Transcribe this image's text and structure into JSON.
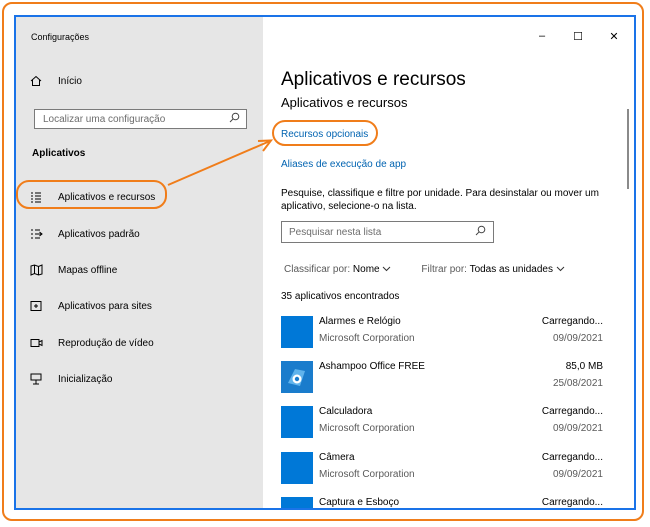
{
  "window": {
    "title": "Configurações",
    "controls": {
      "minimize": "–",
      "maximize": "☐",
      "close": "✕"
    }
  },
  "sidebar": {
    "home_label": "Início",
    "search_placeholder": "Localizar uma configuração",
    "section_title": "Aplicativos",
    "items": [
      {
        "label": "Aplicativos e recursos",
        "icon": "apps-features-icon"
      },
      {
        "label": "Aplicativos padrão",
        "icon": "default-apps-icon"
      },
      {
        "label": "Mapas offline",
        "icon": "offline-maps-icon"
      },
      {
        "label": "Aplicativos para sites",
        "icon": "apps-for-websites-icon"
      },
      {
        "label": "Reprodução de vídeo",
        "icon": "video-playback-icon"
      },
      {
        "label": "Inicialização",
        "icon": "startup-icon"
      }
    ]
  },
  "main": {
    "title": "Aplicativos e recursos",
    "subtitle": "Aplicativos e recursos",
    "link_optional": "Recursos opcionais",
    "link_aliases": "Aliases de execução de app",
    "description": "Pesquise, classifique e filtre por unidade. Para desinstalar ou mover um aplicativo, selecione-o na lista.",
    "search_placeholder": "Pesquisar nesta lista",
    "sort_label": "Classificar por:",
    "sort_value": "Nome",
    "filter_label": "Filtrar por:",
    "filter_value": "Todas as unidades",
    "count_text": "35 aplicativos encontrados",
    "apps": [
      {
        "name": "Alarmes e Relógio",
        "publisher": "Microsoft Corporation",
        "size": "Carregando...",
        "date": "09/09/2021"
      },
      {
        "name": "Ashampoo Office FREE",
        "publisher": "",
        "size": "85,0 MB",
        "date": "25/08/2021"
      },
      {
        "name": "Calculadora",
        "publisher": "Microsoft Corporation",
        "size": "Carregando...",
        "date": "09/09/2021"
      },
      {
        "name": "Câmera",
        "publisher": "Microsoft Corporation",
        "size": "Carregando...",
        "date": "09/09/2021"
      },
      {
        "name": "Captura e Esboço",
        "publisher": "",
        "size": "Carregando...",
        "date": ""
      }
    ]
  },
  "colors": {
    "accent": "#0078d7",
    "link": "#0063b1",
    "annotation": "#f07d1a",
    "window_border": "#1a73e8",
    "sidebar_bg": "#e6e6e6"
  }
}
